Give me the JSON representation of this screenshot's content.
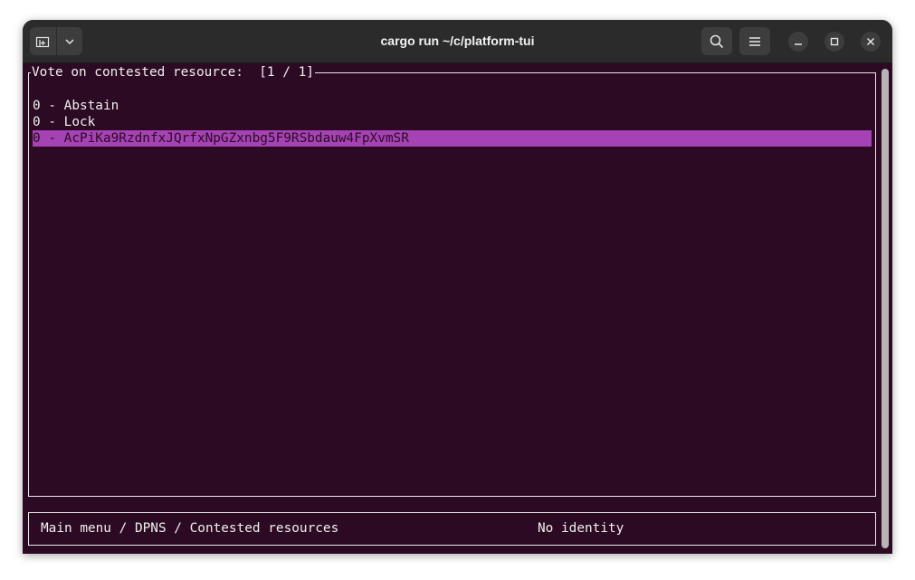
{
  "window": {
    "title": "cargo run ~/c/platform-tui"
  },
  "panel": {
    "title": "Vote on contested resource:  [1 / 1]",
    "items": [
      {
        "label": "0 - Abstain",
        "selected": false
      },
      {
        "label": "0 - Lock",
        "selected": false
      },
      {
        "label": "0 - AcPiKa9RzdnfxJQrfxNpGZxnbg5F9RSbdauw4FpXvmSR",
        "selected": true
      }
    ]
  },
  "status_bar": {
    "breadcrumb": "Main menu / DPNS / Contested resources",
    "identity": "No identity"
  },
  "colors": {
    "terminal_bg": "#2c0a23",
    "selection": "#a543b4",
    "titlebar": "#2b2b2b"
  },
  "icons": {
    "new_tab": "new-tab-icon",
    "dropdown": "chevron-down-icon",
    "search": "search-icon",
    "menu": "hamburger-menu-icon",
    "minimize": "minimize-icon",
    "maximize": "maximize-icon",
    "close": "close-icon"
  }
}
